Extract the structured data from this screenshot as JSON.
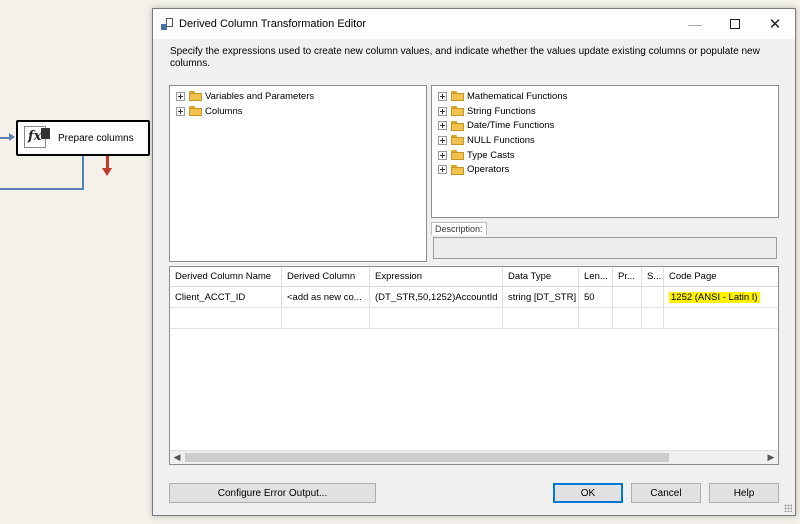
{
  "canvas": {
    "task_label": "Prepare columns"
  },
  "dialog": {
    "title": "Derived Column Transformation Editor",
    "instructions": "Specify the expressions used to create new column values, and indicate whether the values update existing columns or populate new columns.",
    "left_tree": [
      {
        "label": "Variables and Parameters",
        "icon": "folder-icon"
      },
      {
        "label": "Columns",
        "icon": "folder-icon"
      }
    ],
    "right_tree": [
      {
        "label": "Mathematical Functions",
        "icon": "folder-icon"
      },
      {
        "label": "String Functions",
        "icon": "folder-icon"
      },
      {
        "label": "Date/Time Functions",
        "icon": "folder-icon"
      },
      {
        "label": "NULL Functions",
        "icon": "folder-icon"
      },
      {
        "label": "Type Casts",
        "icon": "folder-icon"
      },
      {
        "label": "Operators",
        "icon": "folder-icon"
      }
    ],
    "description_label": "Description:",
    "grid": {
      "headers": [
        "Derived Column Name",
        "Derived Column",
        "Expression",
        "Data Type",
        "Len...",
        "Pr...",
        "S...",
        "Code Page"
      ],
      "rows": [
        {
          "name": "Client_ACCT_ID",
          "derived": "<add as new co...",
          "expression": "(DT_STR,50,1252)AccountId",
          "data_type": "string [DT_STR]",
          "length": "50",
          "precision": "",
          "scale": "",
          "code_page": "1252  (ANSI - Latin I)"
        }
      ],
      "highlight_color": "#fff200"
    },
    "buttons": {
      "configure": "Configure Error Output...",
      "ok": "OK",
      "cancel": "Cancel",
      "help": "Help"
    },
    "window_controls": {
      "minimize": "—",
      "close": "✕"
    }
  }
}
